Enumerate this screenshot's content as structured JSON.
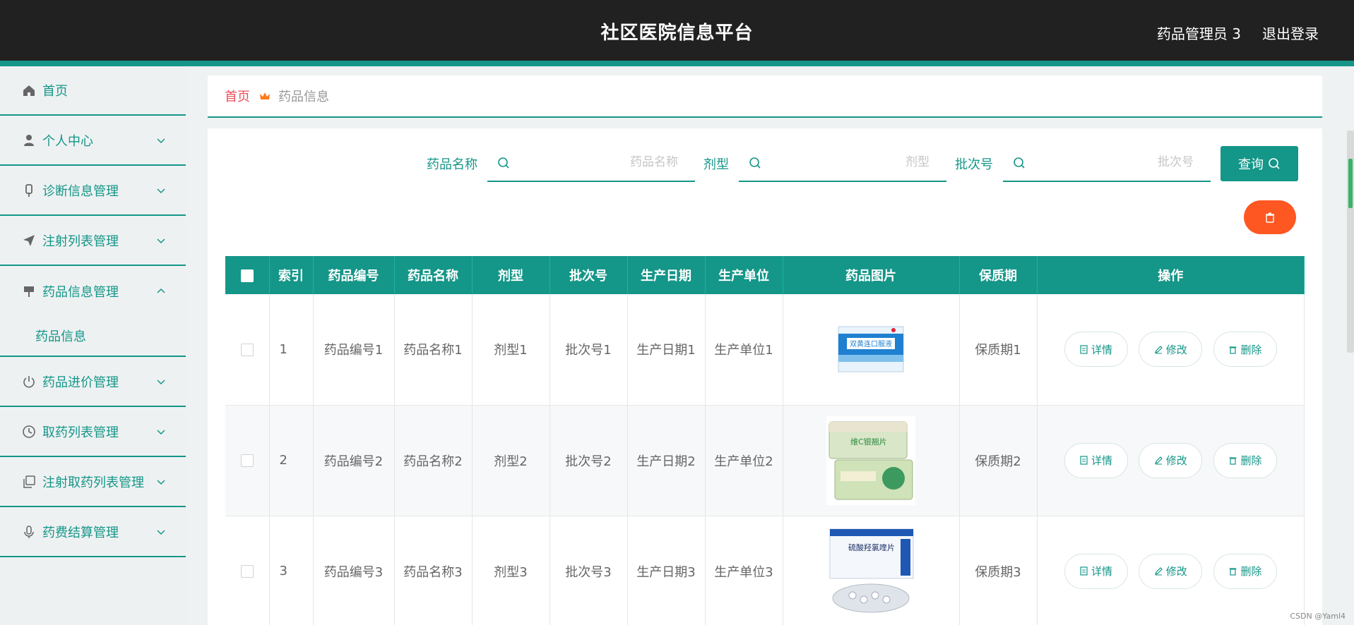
{
  "header": {
    "title": "社区医院信息平台",
    "user": "药品管理员 3",
    "logout": "退出登录"
  },
  "sidebar": {
    "items": [
      {
        "label": "首页",
        "icon": "home-icon"
      },
      {
        "label": "个人中心",
        "icon": "user-icon"
      },
      {
        "label": "诊断信息管理",
        "icon": "microphone-stand-icon"
      },
      {
        "label": "注射列表管理",
        "icon": "paper-plane-icon"
      },
      {
        "label": "药品信息管理",
        "icon": "sign-icon"
      },
      {
        "label": "药品进价管理",
        "icon": "power-icon"
      },
      {
        "label": "取药列表管理",
        "icon": "clock-icon"
      },
      {
        "label": "注射取药列表管理",
        "icon": "copy-icon"
      },
      {
        "label": "药费结算管理",
        "icon": "mic-icon"
      }
    ],
    "subitem": "药品信息"
  },
  "breadcrumb": {
    "home": "首页",
    "current": "药品信息"
  },
  "search": {
    "name_label": "药品名称",
    "name_placeholder": "药品名称",
    "form_label": "剂型",
    "form_placeholder": "剂型",
    "batch_label": "批次号",
    "batch_placeholder": "批次号",
    "query_button": "查询"
  },
  "table": {
    "headers": [
      "索引",
      "药品编号",
      "药品名称",
      "剂型",
      "批次号",
      "生产日期",
      "生产单位",
      "药品图片",
      "保质期",
      "操作"
    ],
    "rows": [
      {
        "index": "1",
        "code": "药品编号1",
        "name": "药品名称1",
        "form": "剂型1",
        "batch": "批次号1",
        "date": "生产日期1",
        "maker": "生产单位1",
        "shelf": "保质期1",
        "image_text": "双黄连口服液"
      },
      {
        "index": "2",
        "code": "药品编号2",
        "name": "药品名称2",
        "form": "剂型2",
        "batch": "批次号2",
        "date": "生产日期2",
        "maker": "生产单位2",
        "shelf": "保质期2",
        "image_text": "维C银翘片"
      },
      {
        "index": "3",
        "code": "药品编号3",
        "name": "药品名称3",
        "form": "剂型3",
        "batch": "批次号3",
        "date": "生产日期3",
        "maker": "生产单位3",
        "shelf": "保质期3",
        "image_text": "硫酸羟氯喹片"
      }
    ],
    "actions": {
      "detail": "详情",
      "edit": "修改",
      "delete": "删除"
    }
  },
  "watermark": "CSDN @Yaml4",
  "colors": {
    "primary": "#149688",
    "danger": "#ff5722",
    "breadcrumb_home": "#e94e5a"
  }
}
